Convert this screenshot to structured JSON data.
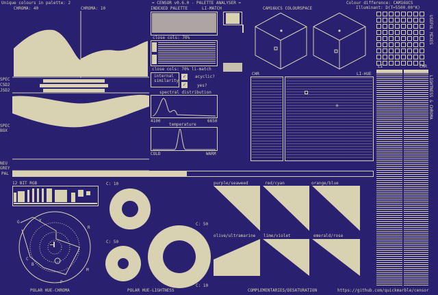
{
  "header": {
    "unique_colours": "Unique colours in palette: 2",
    "title": "= CENSOR v0.6.0 - PALETTE ANALYSER =",
    "colour_difference": "Colour difference: CAM16UCS",
    "illuminant": "Illuminant: D(T=5500.00°K)"
  },
  "labels": {
    "chroma_40": "CHROMA: 40",
    "chroma_10": "CHROMA: 10",
    "indexed_palette": "INDEXED PALETTE",
    "li_match": "LI-MATCH",
    "cam16": "CAM16UCS COLOURSPACE",
    "close_cols_70": "close cols: 70%",
    "close_cols_70b": "close cols: 70% li-match",
    "internal_similarity": "internal\nsimilarity",
    "acyclic": "acyclic?",
    "yes": "yes?",
    "spectral": "spectral distribution",
    "nm_low": "4100",
    "nm_high": "6650",
    "temperature": "temperature",
    "cold": "COLD",
    "warm": "WARM",
    "chr_a": "CHR",
    "li_hue": "LI-HUE",
    "li": "LI",
    "chr_b": "CHR",
    "spec": "SPEC",
    "csd2": "CSD2",
    "jsd2": "JSD2",
    "spec2": "SPEC",
    "box": "BOX",
    "neu": "NEU",
    "grey": "GREY",
    "pal": "PAL",
    "rgb12": "12 BIT RGB",
    "c10a": "C: 10",
    "c50a": "C: 50",
    "c50b": "C: 50",
    "c10b": "C: 10",
    "purple_seaweed": "purple/seaweed",
    "red_cyan": "red/cyan",
    "orange_blue": "orange/blue",
    "olive_ultramarine": "olive/ultramarine",
    "lime_violet": "lime/violet",
    "emerald_rose": "emerald/rose",
    "polar_hc": "POLAR HUE-CHROMA",
    "polar_hl": "POLAR HUE-LIGHTNESS",
    "complementaries": "COMPLEMENTARIES/DESATURATION",
    "url": "https://github.com/quickmarble/censor",
    "side_useful": "USEFUL MIXES",
    "side_lightness": "LIGHTNESS & CHROMA",
    "polar_letters": [
      "G",
      "Y",
      "R",
      "C",
      "B",
      "M",
      "P"
    ]
  },
  "colors": {
    "background": "#2a2070",
    "foreground": "#d8d2b2"
  }
}
